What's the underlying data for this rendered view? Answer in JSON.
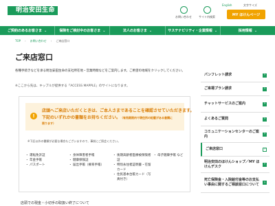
{
  "header": {
    "brand": "明治安田生命",
    "icons": [
      {
        "name": "contact-icon",
        "label": "お問い合わせ"
      },
      {
        "name": "search-icon",
        "label": "サイト内検索"
      }
    ],
    "lang": "English",
    "font_size": "文字サイズ",
    "mypage": "MY ほけんページ"
  },
  "nav": [
    {
      "label": "ご契約のあるお客さま"
    },
    {
      "label": "保険をご検討中のお客さま"
    },
    {
      "label": "法人のお客さま"
    },
    {
      "label": "サステナビリティ・企業情報"
    },
    {
      "label": "採用情報"
    }
  ],
  "breadcrumb": {
    "top": "TOP",
    "mid": "お問い合わせ",
    "current": "ご来店窓口"
  },
  "page": {
    "title": "ご来店窓口",
    "intro": "各種手続きなどを承る明治安田生命の支社所在地・営業時間などをご案内します。ご希望の地域をクリックしてください。",
    "intro_note": "※ここから先は、キップルが提供する「ACCESS MAPPLE」のサイトになります。"
  },
  "notice": {
    "line1": "店頭へご来店いただくときは、ご本人さまであることを確認させていただきます。",
    "line2": "下記のいずれかの書類をお持ちください。",
    "line2_note": "（有効期限内で現住所の記載がある書類に",
    "line3": "限ります）",
    "docs_note": "※下記以外の書類が必要な場合もございますので、事前にご照会ください。",
    "cols": [
      [
        "運転免許証",
        "年金手帳",
        "パスポート"
      ],
      [
        "身体障害者手帳",
        "健康保険証",
        "届出手帳（療育手帳）"
      ],
      [
        "後期高齢者医療被保険者証",
        "特別永住者証明書・在留カード",
        "住民基本台帳カード（写真付き）"
      ],
      [
        "母子健康手帳 など"
      ]
    ]
  },
  "section_head": "店頭での現金・小切手の取扱い終了について",
  "sidebar": [
    {
      "label": "パンフレット請求",
      "active": false
    },
    {
      "label": "ご来場プラン請求",
      "active": false
    },
    {
      "label": "チャットサービスのご案内",
      "active": false
    },
    {
      "label": "よくあるご質問",
      "active": false
    },
    {
      "label": "コミュニケーションセンターのご案内",
      "active": false
    },
    {
      "label": "ご来店窓口",
      "active": true
    },
    {
      "label": "明治安田のほけんショップ／MY ほけんデスク",
      "active": false
    },
    {
      "label": "死亡保険金・入院給付金等のお支払い事由に関するご相談窓口について",
      "active": false
    }
  ],
  "colors": {
    "brand": "#1a9b5a",
    "accent": "#f1a300",
    "warn_bg": "#fdf2dc",
    "warn_text": "#d97a00"
  }
}
